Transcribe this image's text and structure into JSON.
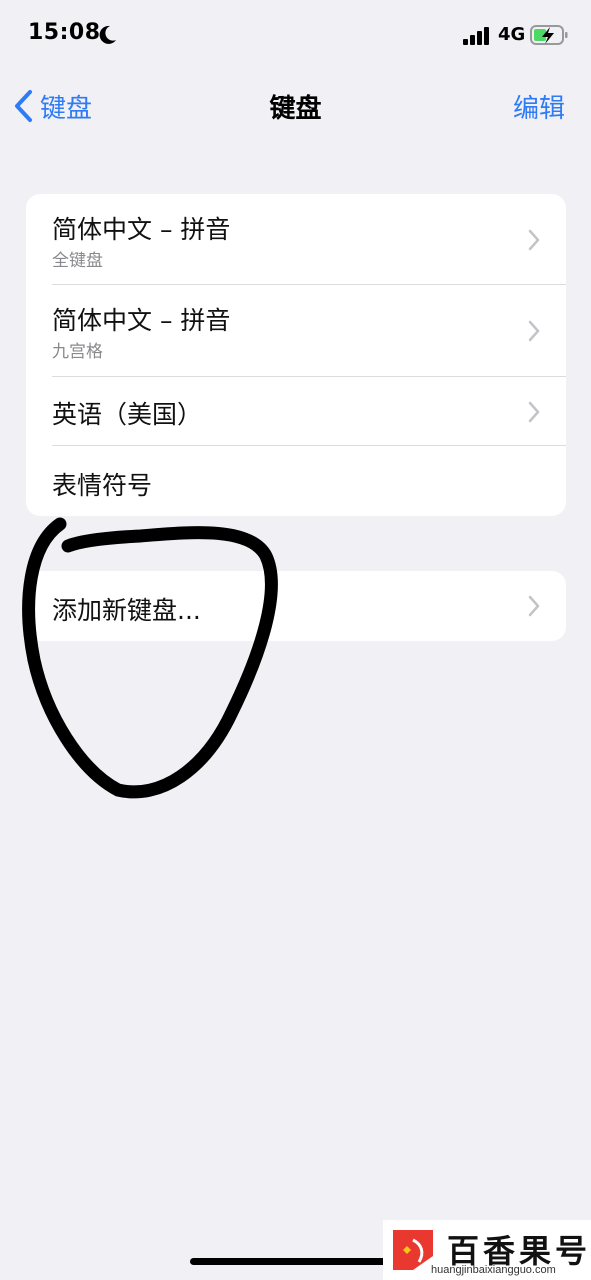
{
  "status_bar": {
    "time": "15:08",
    "network": "4G",
    "icons": [
      "moon-icon",
      "signal-icon",
      "battery-charging-icon"
    ]
  },
  "nav": {
    "back_label": "键盘",
    "title": "键盘",
    "edit_label": "编辑"
  },
  "keyboards": [
    {
      "title": "简体中文 – 拼音",
      "subtitle": "全键盘"
    },
    {
      "title": "简体中文 – 拼音",
      "subtitle": "九宫格"
    },
    {
      "title": "英语（美国）"
    },
    {
      "title": "表情符号"
    }
  ],
  "add_keyboard": {
    "label": "添加新键盘..."
  },
  "watermark": {
    "name": "百香果号",
    "url": "huangjinbaixiangguo.com"
  },
  "colors": {
    "accent": "#2f7bf6",
    "background": "#f0f0f5",
    "annotation": "#000000",
    "watermark_red": "#e8382f"
  }
}
